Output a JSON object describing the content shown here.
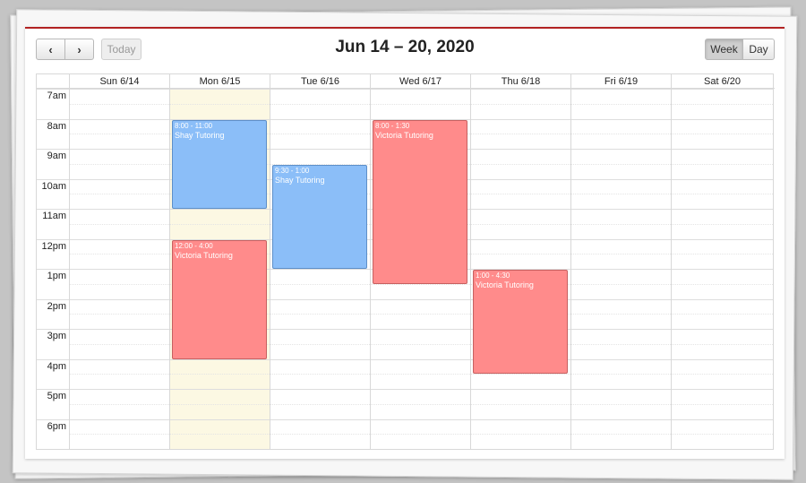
{
  "toolbar": {
    "prev_icon": "chevron-left-icon",
    "next_icon": "chevron-right-icon",
    "today_label": "Today",
    "title": "Jun 14 – 20, 2020",
    "view_week_label": "Week",
    "view_day_label": "Day",
    "active_view": "Week"
  },
  "days": [
    {
      "label": "Sun 6/14"
    },
    {
      "label": "Mon 6/15"
    },
    {
      "label": "Tue 6/16"
    },
    {
      "label": "Wed 6/17"
    },
    {
      "label": "Thu 6/18"
    },
    {
      "label": "Fri 6/19"
    },
    {
      "label": "Sat 6/20"
    }
  ],
  "today_index": 1,
  "slot_start_hour": 7,
  "slot_end_hour": 19,
  "time_labels": [
    "7am",
    "8am",
    "9am",
    "10am",
    "11am",
    "12pm",
    "1pm",
    "2pm",
    "3pm",
    "4pm",
    "5pm",
    "6pm"
  ],
  "events": [
    {
      "day": 1,
      "start": 8,
      "end": 11,
      "time_text": "8:00 - 11:00",
      "title": "Shay Tutoring",
      "kind": "blue"
    },
    {
      "day": 1,
      "start": 12,
      "end": 16,
      "time_text": "12:00 - 4:00",
      "title": "Victoria Tutoring",
      "kind": "red"
    },
    {
      "day": 2,
      "start": 9.5,
      "end": 13,
      "time_text": "9:30 - 1:00",
      "title": "Shay Tutoring",
      "kind": "blue"
    },
    {
      "day": 3,
      "start": 8,
      "end": 13.5,
      "time_text": "8:00 - 1:30",
      "title": "Victoria Tutoring",
      "kind": "red"
    },
    {
      "day": 4,
      "start": 13,
      "end": 16.5,
      "time_text": "1:00 - 4:30",
      "title": "Victoria Tutoring",
      "kind": "red"
    }
  ],
  "colors": {
    "accent": "#b22222",
    "event_blue": "#8bbef8",
    "event_red": "#ff8b8b",
    "today_highlight": "#fcf8e3"
  }
}
